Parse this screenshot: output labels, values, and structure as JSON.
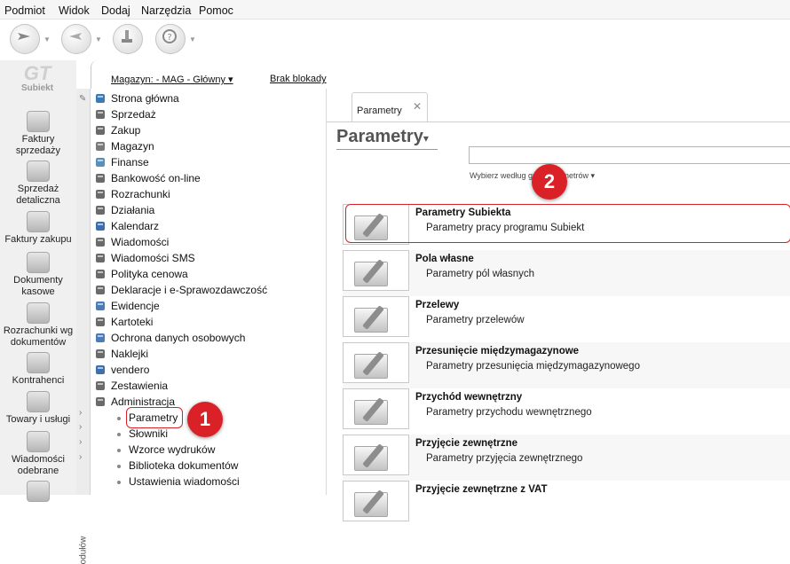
{
  "menubar": {
    "items": [
      "Podmiot",
      "Widok",
      "Dodaj",
      "Narzędzia",
      "Pomoc"
    ]
  },
  "toolbar": {
    "buttons": [
      {
        "icon": "send-icon"
      },
      {
        "icon": "receive-icon"
      },
      {
        "icon": "wrench-icon"
      },
      {
        "icon": "help-icon"
      }
    ]
  },
  "logo": {
    "text": "Subiekt"
  },
  "leftnav": {
    "items": [
      {
        "label": "Faktury sprzedaży",
        "icon": "sales-invoices-icon"
      },
      {
        "label": "Sprzedaż detaliczna",
        "icon": "retail-icon"
      },
      {
        "label": "Faktury zakupu",
        "icon": "purchase-invoices-icon"
      },
      {
        "label": "Dokumenty kasowe",
        "icon": "cash-documents-icon"
      },
      {
        "label": "Rozrachunki wg dokumentów",
        "icon": "settlements-icon"
      },
      {
        "label": "Kontrahenci",
        "icon": "contractors-icon"
      },
      {
        "label": "Towary i usługi",
        "icon": "goods-icon"
      },
      {
        "label": "Wiadomości odebrane",
        "icon": "messages-icon"
      }
    ]
  },
  "sidestrip": {
    "text": "odułów"
  },
  "header": {
    "warehouse": "Magazyn: - MAG - Główny ▾",
    "lock": "Brak blokady"
  },
  "tree": {
    "nodes": [
      {
        "label": "Strona główna",
        "icon": "home-icon",
        "color": "#3a7ab5"
      },
      {
        "label": "Sprzedaż",
        "icon": "sales-icon",
        "color": "#6a6a6a"
      },
      {
        "label": "Zakup",
        "icon": "purchase-icon",
        "color": "#6a6a6a"
      },
      {
        "label": "Magazyn",
        "icon": "warehouse-icon",
        "color": "#7a7a7a"
      },
      {
        "label": "Finanse",
        "icon": "finance-icon",
        "color": "#5a8fb8"
      },
      {
        "label": "Bankowość on-line",
        "icon": "bank-icon",
        "color": "#6a6a6a"
      },
      {
        "label": "Rozrachunki",
        "icon": "settlements-icon",
        "color": "#6a6a6a"
      },
      {
        "label": "Działania",
        "icon": "actions-icon",
        "color": "#6a6a6a"
      },
      {
        "label": "Kalendarz",
        "icon": "calendar-icon",
        "color": "#3d6fae"
      },
      {
        "label": "Wiadomości",
        "icon": "mail-icon",
        "color": "#6a6a6a"
      },
      {
        "label": "Wiadomości SMS",
        "icon": "sms-icon",
        "color": "#6a6a6a"
      },
      {
        "label": "Polityka cenowa",
        "icon": "pricing-icon",
        "color": "#6a6a6a"
      },
      {
        "label": "Deklaracje i e-Sprawozdawczość",
        "icon": "declarations-icon",
        "color": "#6a6a6a"
      },
      {
        "label": "Ewidencje",
        "icon": "records-icon",
        "color": "#4a7db8"
      },
      {
        "label": "Kartoteki",
        "icon": "files-icon",
        "color": "#6a6a6a"
      },
      {
        "label": "Ochrona danych osobowych",
        "icon": "privacy-icon",
        "color": "#4a7db8"
      },
      {
        "label": "Naklejki",
        "icon": "stickers-icon",
        "color": "#6a6a6a"
      },
      {
        "label": "vendero",
        "icon": "vendero-icon",
        "color": "#3d6fae"
      },
      {
        "label": "Zestawienia",
        "icon": "reports-icon",
        "color": "#6a6a6a"
      },
      {
        "label": "Administracja",
        "icon": "admin-icon",
        "color": "#6a6a6a"
      }
    ],
    "children": [
      "Parametry",
      "Słowniki",
      "Wzorce wydruków",
      "Biblioteka dokumentów",
      "Ustawienia wiadomości"
    ]
  },
  "content": {
    "tab": "Parametry",
    "title": "Parametry",
    "filter": "Wybierz według grup parametrów ▾",
    "rows": [
      {
        "title": "Parametry Subiekta",
        "desc": "Parametry pracy programu Subiekt"
      },
      {
        "title": "Pola własne",
        "desc": "Parametry pól własnych"
      },
      {
        "title": "Przelewy",
        "desc": "Parametry przelewów"
      },
      {
        "title": "Przesunięcie międzymagazynowe",
        "desc": "Parametry przesunięcia międzymagazynowego"
      },
      {
        "title": "Przychód wewnętrzny",
        "desc": "Parametry przychodu wewnętrznego"
      },
      {
        "title": "Przyjęcie zewnętrzne",
        "desc": "Parametry przyjęcia zewnętrznego"
      },
      {
        "title": "Przyjęcie zewnętrzne z VAT",
        "desc": ""
      }
    ]
  },
  "annotations": {
    "badge1": "1",
    "badge2": "2",
    "color": "#da2128"
  }
}
